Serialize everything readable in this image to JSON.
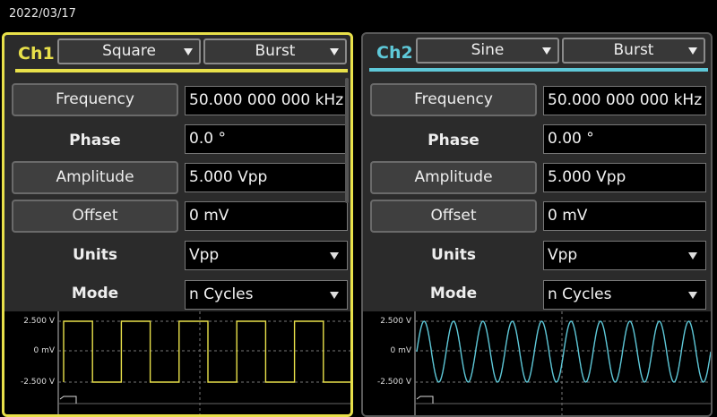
{
  "header": {
    "date": "2022/03/17"
  },
  "channels": [
    {
      "label": "Ch1",
      "color": "#e8e04a",
      "waveform": "Square",
      "mode_select": "Burst",
      "fields": {
        "frequency_label": "Frequency",
        "frequency_value": "50.000 000 000 kHz",
        "phase_label": "Phase",
        "phase_value": "0.0 °",
        "amplitude_label": "Amplitude",
        "amplitude_value": "5.000 Vpp",
        "offset_label": "Offset",
        "offset_value": "0 mV",
        "units_label": "Units",
        "units_value": "Vpp",
        "mode_label": "Mode",
        "mode_value": "n Cycles"
      },
      "preview": {
        "ymax": "2.500 V",
        "ymid": "0 mV",
        "ymin": "-2.500 V",
        "cycles": 5
      }
    },
    {
      "label": "Ch2",
      "color": "#5ec8d8",
      "waveform": "Sine",
      "mode_select": "Burst",
      "fields": {
        "frequency_label": "Frequency",
        "frequency_value": "50.000 000 000 kHz",
        "phase_label": "Phase",
        "phase_value": "0.00 °",
        "amplitude_label": "Amplitude",
        "amplitude_value": "5.000 Vpp",
        "offset_label": "Offset",
        "offset_value": "0 mV",
        "units_label": "Units",
        "units_value": "Vpp",
        "mode_label": "Mode",
        "mode_value": "n Cycles"
      },
      "preview": {
        "ymax": "2.500 V",
        "ymid": "0 mV",
        "ymin": "-2.500 V",
        "cycles": 10
      }
    }
  ]
}
